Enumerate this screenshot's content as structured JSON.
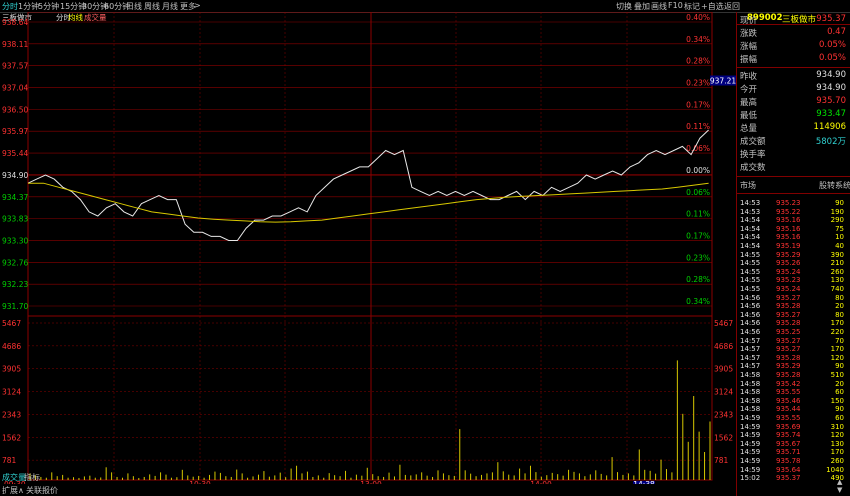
{
  "toolbar": {
    "left": [
      "分时",
      "1分钟",
      "5分钟",
      "15分钟",
      "30分钟",
      "60分钟",
      "日线",
      "周线",
      "月线",
      "更多",
      ">"
    ],
    "right": [
      "切换",
      "叠加",
      "画线",
      "F10",
      "标记",
      "+自选",
      "返回"
    ]
  },
  "chart_header": {
    "name": "三板做市",
    "tabs": [
      "分时",
      "均线",
      "成交量"
    ]
  },
  "price_axis": {
    "left_labels": [
      "938.64",
      "938.11",
      "937.57",
      "937.04",
      "936.50",
      "935.97",
      "935.44",
      "934.90",
      "934.37",
      "933.83",
      "933.30",
      "932.76",
      "932.23",
      "931.70"
    ],
    "right_labels": [
      "0.40%",
      "0.34%",
      "0.28%",
      "0.23%",
      "0.17%",
      "0.11%",
      "0.06%",
      "0.00%",
      "0.06%",
      "0.11%",
      "0.17%",
      "0.23%",
      "0.28%",
      "0.34%"
    ],
    "current_tag": "937.21"
  },
  "volume_axis": {
    "labels": [
      "5467",
      "4686",
      "3905",
      "3124",
      "2343",
      "1562",
      "781"
    ],
    "title": "成交量"
  },
  "time_axis": {
    "start": "09:30",
    "labels": [
      "10:30",
      "13:00",
      "14:00"
    ],
    "cursor": "14:38"
  },
  "bottom_bar": {
    "vol_tab": "成交量",
    "indicator": "指标",
    "expand": "扩展∧",
    "related": "关联报价"
  },
  "chart_data": {
    "type": "line",
    "x_range": [
      "09:30",
      "15:00"
    ],
    "ylim": [
      931.7,
      938.64
    ],
    "prev_close": 934.9,
    "price": [
      934.7,
      934.8,
      934.9,
      934.8,
      934.6,
      934.5,
      934.3,
      934.0,
      933.9,
      934.1,
      934.2,
      934.0,
      933.9,
      934.2,
      934.3,
      934.4,
      934.3,
      934.3,
      933.7,
      933.5,
      933.5,
      933.4,
      933.4,
      933.3,
      933.3,
      933.6,
      933.8,
      933.8,
      933.9,
      933.9,
      934.0,
      934.1,
      934.0,
      934.4,
      934.6,
      934.8,
      934.9,
      935.0,
      935.1,
      935.1,
      935.3,
      935.5,
      935.4,
      935.5,
      934.6,
      934.5,
      934.4,
      934.5,
      934.4,
      934.5,
      934.4,
      934.5,
      934.4,
      934.3,
      934.3,
      934.4,
      934.5,
      934.3,
      934.5,
      934.4,
      934.6,
      934.5,
      934.6,
      934.7,
      934.9,
      934.8,
      934.9,
      935.0,
      934.9,
      935.1,
      935.2,
      935.4,
      935.5,
      935.4,
      935.5,
      935.6,
      935.4,
      935.8,
      936.0
    ],
    "avg": [
      934.7,
      934.7,
      934.6,
      934.5,
      934.4,
      934.3,
      934.2,
      934.1,
      934.0,
      933.95,
      933.9,
      933.85,
      933.82,
      933.8,
      933.78,
      933.76,
      933.75,
      933.76,
      933.78,
      933.8,
      933.85,
      933.9,
      933.95,
      934.0,
      934.05,
      934.1,
      934.15,
      934.2,
      934.25,
      934.3,
      934.33,
      934.36,
      934.38,
      934.4,
      934.42,
      934.44,
      934.46,
      934.48,
      934.5,
      934.52,
      934.54,
      934.56,
      934.6,
      934.65,
      934.7
    ],
    "volume": [
      260,
      180,
      120,
      90,
      300,
      150,
      200,
      90,
      110,
      80,
      140,
      170,
      90,
      100,
      500,
      300,
      120,
      90,
      260,
      150,
      80,
      120,
      220,
      160,
      300,
      210,
      90,
      110,
      400,
      180,
      130,
      160,
      90,
      200,
      330,
      280,
      150,
      120,
      410,
      260,
      90,
      140,
      210,
      350,
      130,
      180,
      290,
      110,
      450,
      560,
      260,
      330,
      120,
      180,
      90,
      270,
      190,
      150,
      360,
      90,
      210,
      170,
      480,
      230,
      150,
      120,
      290,
      140,
      600,
      200,
      180,
      220,
      300,
      170,
      120,
      380,
      260,
      190,
      160,
      2000,
      380,
      250,
      150,
      200,
      260,
      300,
      700,
      340,
      210,
      180,
      450,
      260,
      560,
      310,
      130,
      190,
      280,
      230,
      170,
      400,
      320,
      260,
      150,
      220,
      380,
      240,
      180,
      900,
      310,
      200,
      260,
      180,
      1200,
      400,
      360,
      250,
      800,
      430,
      300,
      4700,
      2600,
      1500,
      3300,
      1900,
      1100,
      2300
    ]
  },
  "quote": {
    "code": "899002",
    "name": "三板做市",
    "rows": [
      {
        "k": "现价",
        "v": "935.37",
        "c": "#ff3232"
      },
      {
        "k": "涨跌",
        "v": "0.47",
        "c": "#ff3232"
      },
      {
        "k": "涨幅",
        "v": "0.05%",
        "c": "#ff3232"
      },
      {
        "k": "振幅",
        "v": "0.05%",
        "c": "#ff3232"
      }
    ],
    "rows2": [
      {
        "k": "昨收",
        "v": "934.90",
        "c": "#e0e0e0"
      },
      {
        "k": "今开",
        "v": "934.90",
        "c": "#e0e0e0"
      },
      {
        "k": "最高",
        "v": "935.70",
        "c": "#ff3232"
      },
      {
        "k": "最低",
        "v": "933.47",
        "c": "#00e600"
      },
      {
        "k": "总量",
        "v": "114906",
        "c": "#ffff00"
      },
      {
        "k": "成交额",
        "v": "5802万",
        "c": "#30d0d0"
      },
      {
        "k": "换手率",
        "v": "",
        "c": "#e0e0e0"
      },
      {
        "k": "成交数",
        "v": "",
        "c": "#e0e0e0"
      }
    ],
    "section": {
      "left": "市场",
      "right": "股转系统"
    }
  },
  "ticks": [
    [
      "14:53",
      "935.23",
      "90"
    ],
    [
      "14:53",
      "935.22",
      "190"
    ],
    [
      "14:54",
      "935.16",
      "290"
    ],
    [
      "14:54",
      "935.16",
      "75"
    ],
    [
      "14:54",
      "935.16",
      "10"
    ],
    [
      "14:54",
      "935.19",
      "40"
    ],
    [
      "14:55",
      "935.29",
      "390"
    ],
    [
      "14:55",
      "935.26",
      "210"
    ],
    [
      "14:55",
      "935.24",
      "260"
    ],
    [
      "14:55",
      "935.23",
      "130"
    ],
    [
      "14:55",
      "935.24",
      "740"
    ],
    [
      "14:56",
      "935.27",
      "80"
    ],
    [
      "14:56",
      "935.28",
      "20"
    ],
    [
      "14:56",
      "935.27",
      "80"
    ],
    [
      "14:56",
      "935.28",
      "170"
    ],
    [
      "14:56",
      "935.25",
      "220"
    ],
    [
      "14:57",
      "935.27",
      "70"
    ],
    [
      "14:57",
      "935.27",
      "170"
    ],
    [
      "14:57",
      "935.28",
      "120"
    ],
    [
      "14:57",
      "935.29",
      "90"
    ],
    [
      "14:58",
      "935.28",
      "510"
    ],
    [
      "14:58",
      "935.42",
      "20"
    ],
    [
      "14:58",
      "935.55",
      "60"
    ],
    [
      "14:58",
      "935.46",
      "150"
    ],
    [
      "14:58",
      "935.44",
      "90"
    ],
    [
      "14:59",
      "935.55",
      "60"
    ],
    [
      "14:59",
      "935.69",
      "310"
    ],
    [
      "14:59",
      "935.74",
      "120"
    ],
    [
      "14:59",
      "935.67",
      "130"
    ],
    [
      "14:59",
      "935.71",
      "170"
    ],
    [
      "14:59",
      "935.78",
      "260"
    ],
    [
      "14:59",
      "935.64",
      "1040"
    ],
    [
      "15:02",
      "935.37",
      "490"
    ]
  ],
  "tick_colors": {
    "price": "#ff3232",
    "vol": "#ffff00",
    "time": "#e0e0e0"
  },
  "scroll_icons": [
    "up-arrow",
    "down-arrow"
  ]
}
